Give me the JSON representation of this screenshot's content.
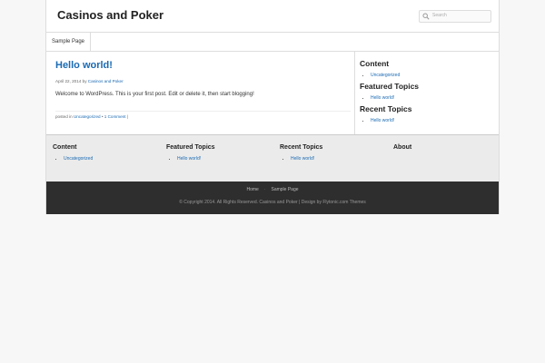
{
  "header": {
    "site_title": "Casinos and Poker",
    "search_placeholder": "Search"
  },
  "nav": {
    "items": [
      "Sample Page"
    ]
  },
  "post": {
    "title": "Hello world!",
    "date": "April 22, 2014",
    "by": "by",
    "author": "Casinos and Poker",
    "body": "Welcome to WordPress. This is your first post. Edit or delete it, then start blogging!",
    "posted_in": "posted in",
    "category": "Uncategorized",
    "bullet": "•",
    "comments": "1 Comment",
    "pipe": "|"
  },
  "sidebar": {
    "widgets": [
      {
        "title": "Content",
        "items": [
          "Uncategorized"
        ]
      },
      {
        "title": "Featured Topics",
        "items": [
          "Hello world!"
        ]
      },
      {
        "title": "Recent Topics",
        "items": [
          "Hello world!"
        ]
      }
    ]
  },
  "footer_widgets": [
    {
      "title": "Content",
      "items": [
        "Uncategorized"
      ]
    },
    {
      "title": "Featured Topics",
      "items": [
        "Hello world!"
      ]
    },
    {
      "title": "Recent Topics",
      "items": [
        "Hello world!"
      ]
    },
    {
      "title": "About",
      "items": []
    }
  ],
  "footer": {
    "nav": [
      "Home",
      "Sample Page"
    ],
    "separator": "·",
    "copyright": "© Copyright 2014. All Rights Reserved. Casinos and Poker | Design by Flytonic.com Themes"
  },
  "colors": {
    "link": "#1a6ab3",
    "footer_bg": "#2e2e2e",
    "widget_bg": "#ebebeb"
  }
}
